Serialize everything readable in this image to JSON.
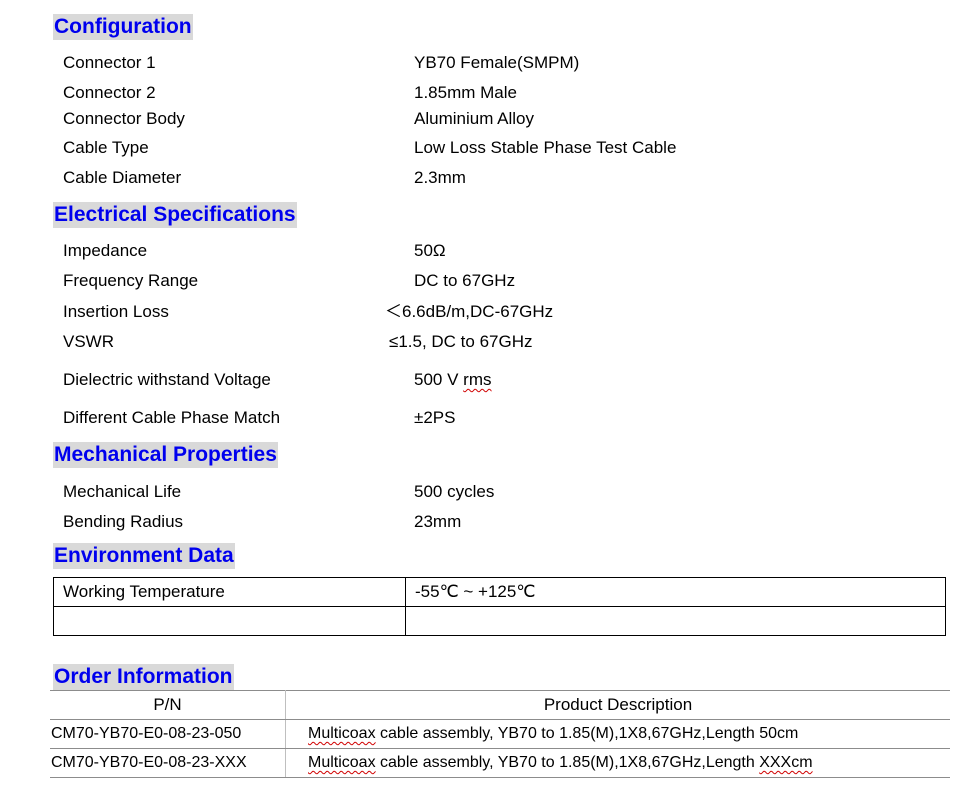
{
  "configuration": {
    "title": "Configuration",
    "rows": [
      {
        "label": "Connector 1",
        "value": "YB70 Female(SMPM)"
      },
      {
        "label": "Connector 2",
        "value": "1.85mm Male"
      },
      {
        "label": "Connector Body",
        "value": "Aluminium Alloy"
      },
      {
        "label": "Cable Type",
        "value": "Low Loss Stable Phase Test Cable"
      },
      {
        "label": "Cable Diameter",
        "value": "2.3mm"
      }
    ]
  },
  "electrical": {
    "title": "Electrical Specifications",
    "rows": [
      {
        "label": "Impedance",
        "value": "50Ω"
      },
      {
        "label": "Frequency Range",
        "value": "DC to 67GHz"
      },
      {
        "label": "Insertion Loss",
        "value": "＜6.6dB/m,DC-67GHz"
      },
      {
        "label": "VSWR",
        "value": "≤1.5, DC to 67GHz"
      },
      {
        "label": "Dielectric withstand Voltage",
        "value_main": "500 V ",
        "value_tail": "rms"
      },
      {
        "label": "Different Cable Phase Match",
        "value": "±2PS"
      }
    ]
  },
  "mechanical": {
    "title": "Mechanical Properties",
    "rows": [
      {
        "label": "Mechanical Life",
        "value": "500 cycles"
      },
      {
        "label": "Bending Radius",
        "value": "23mm"
      }
    ]
  },
  "environment": {
    "title": "Environment Data",
    "rows": [
      {
        "label": "Working Temperature",
        "value": "-55℃ ~ +125℃"
      },
      {
        "label": "",
        "value": ""
      }
    ]
  },
  "order": {
    "title": "Order Information",
    "headers": {
      "pn": "P/N",
      "description": "Product Description"
    },
    "rows": [
      {
        "pn": "CM70-YB70-E0-08-23-050",
        "desc_word": "Multicoax",
        "desc_rest": " cable assembly, YB70 to 1.85(M),1X8,67GHz,Length 50cm",
        "desc_tail": ""
      },
      {
        "pn": "CM70-YB70-E0-08-23-XXX",
        "desc_word": "Multicoax",
        "desc_rest": " cable assembly,  YB70 to 1.85(M),1X8,67GHz,Length ",
        "desc_tail": "XXXcm"
      }
    ]
  }
}
